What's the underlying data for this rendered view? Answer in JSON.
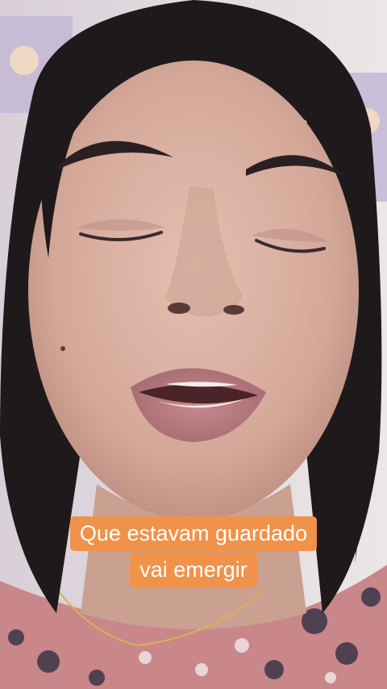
{
  "caption": {
    "line1": "Que estavam guardado",
    "line2": "vai emergir"
  },
  "colors": {
    "caption_background": "#f0924a",
    "caption_text": "#ffffff",
    "wall": "#e6dce0",
    "skin": "#d8b0a2",
    "hair": "#1e1a1c",
    "lips": "#b77a80",
    "shirt": "#c9878a"
  }
}
